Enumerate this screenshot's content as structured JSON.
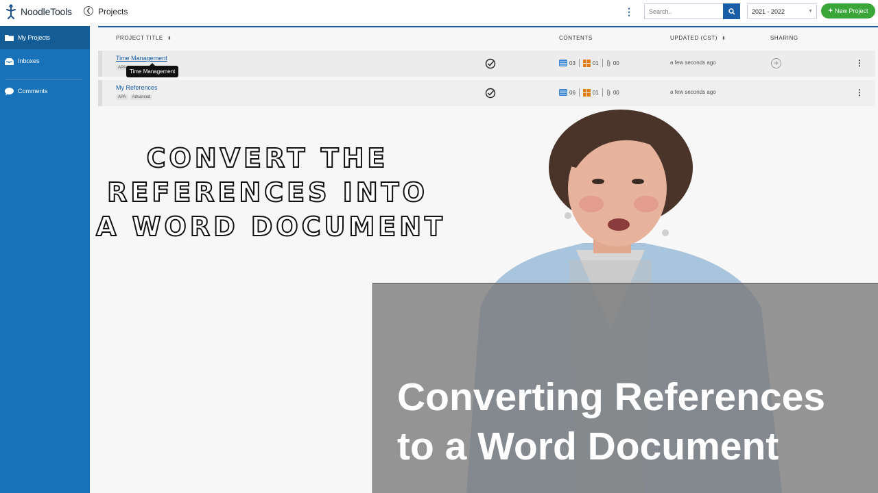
{
  "app": {
    "name": "NoodleTools",
    "page_title": "Projects"
  },
  "toolbar": {
    "search_placeholder": "Search..",
    "year": "2021 - 2022",
    "new_project_label": "New Project"
  },
  "sidebar": {
    "items": [
      {
        "label": "My Projects",
        "icon": "folder-icon",
        "active": true
      },
      {
        "label": "Inboxes",
        "icon": "inbox-icon",
        "active": false
      },
      {
        "label": "Comments",
        "icon": "comment-icon",
        "active": false
      }
    ]
  },
  "table": {
    "headers": {
      "title": "PROJECT TITLE",
      "contents": "CONTENTS",
      "updated": "UPDATED (CST)",
      "sharing": "SHARING"
    },
    "rows": [
      {
        "title": "Time Management",
        "tags": [
          "APA"
        ],
        "sources": "03",
        "notecards": "01",
        "attachments": "00",
        "updated": "a few seconds ago",
        "sharing": "add-share-icon"
      },
      {
        "title": "My References",
        "tags": [
          "APA",
          "Advanced"
        ],
        "sources": "06",
        "notecards": "01",
        "attachments": "00",
        "updated": "a few seconds ago",
        "sharing": ""
      }
    ],
    "tooltip": "Time Management"
  },
  "overlay": {
    "headline_lines": [
      "CONVERT THE",
      "REFERENCES INTO",
      "A WORD DOCUMENT"
    ],
    "lower_third_lines": [
      "Converting References",
      "to a Word Document"
    ]
  },
  "colors": {
    "brand_blue": "#1872b9",
    "accent_green": "#3aa63a",
    "notecard_orange": "#e07b1a"
  }
}
